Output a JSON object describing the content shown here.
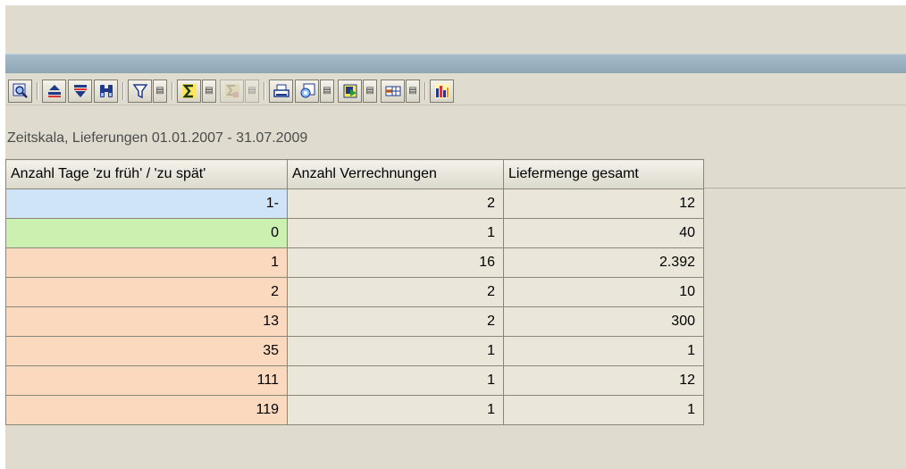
{
  "toolbar": {
    "buttons": [
      {
        "name": "details-button",
        "icon": "magnifier-details-icon"
      },
      {
        "name": "sort-ascending-button",
        "icon": "sort-ascending-icon"
      },
      {
        "name": "sort-descending-button",
        "icon": "sort-descending-icon"
      },
      {
        "name": "find-button",
        "icon": "binoculars-icon"
      },
      {
        "name": "filter-button",
        "icon": "funnel-icon"
      },
      {
        "name": "sum-button",
        "icon": "sigma-icon"
      },
      {
        "name": "subtotal-button",
        "icon": "subtotal-icon",
        "disabled": true
      },
      {
        "name": "print-button",
        "icon": "printer-icon"
      },
      {
        "name": "views-button",
        "icon": "views-icon"
      },
      {
        "name": "export-button",
        "icon": "export-icon"
      },
      {
        "name": "layout-button",
        "icon": "layout-grid-icon"
      },
      {
        "name": "graphic-button",
        "icon": "bar-chart-icon"
      }
    ]
  },
  "report": {
    "title": "Zeitskala, Lieferungen 01.01.2007 - 31.07.2009"
  },
  "table": {
    "columns": [
      "Anzahl Tage 'zu früh' / 'zu spät'",
      "Anzahl Verrechnungen",
      "Liefermenge gesamt"
    ],
    "rows": [
      {
        "days": "1-",
        "count": "2",
        "quantity": "12",
        "status": "early"
      },
      {
        "days": "0",
        "count": "1",
        "quantity": "40",
        "status": "on-time"
      },
      {
        "days": "1",
        "count": "16",
        "quantity": "2.392",
        "status": "late"
      },
      {
        "days": "2",
        "count": "2",
        "quantity": "10",
        "status": "late"
      },
      {
        "days": "13",
        "count": "2",
        "quantity": "300",
        "status": "late"
      },
      {
        "days": "35",
        "count": "1",
        "quantity": "1",
        "status": "late"
      },
      {
        "days": "111",
        "count": "1",
        "quantity": "12",
        "status": "late"
      },
      {
        "days": "119",
        "count": "1",
        "quantity": "1",
        "status": "late"
      }
    ]
  },
  "colors": {
    "early": "#cfe4f7",
    "on_time": "#ccf0b0",
    "late": "#fbd9bf",
    "background": "#dfdccf",
    "title_bar": "#8fa6b6"
  }
}
